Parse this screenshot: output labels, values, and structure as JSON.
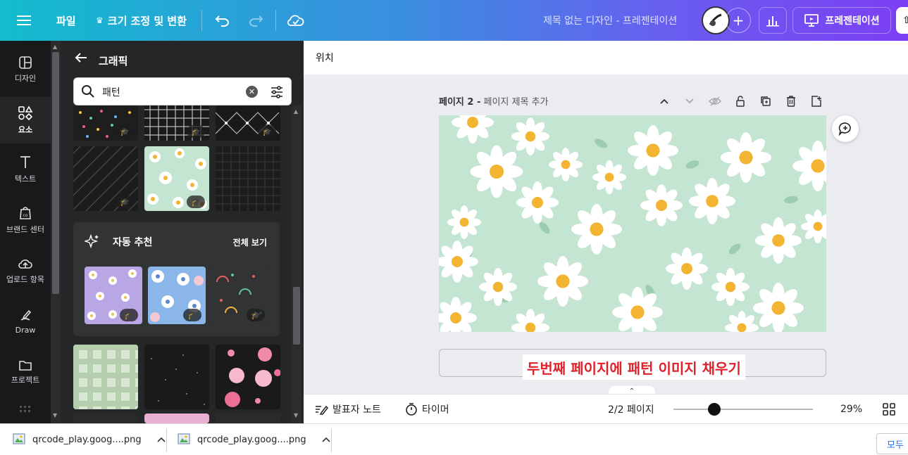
{
  "topbar": {
    "file": "파일",
    "resize": "크기 조정 및 변환",
    "doc_title": "제목 없는 디자인 - 프레젠테이션",
    "present": "프레젠테이션"
  },
  "rail": {
    "items": [
      {
        "label": "디자인",
        "icon": "layout-icon"
      },
      {
        "label": "요소",
        "icon": "shapes-icon"
      },
      {
        "label": "텍스트",
        "icon": "text-icon"
      },
      {
        "label": "브랜드 센터",
        "icon": "brand-icon"
      },
      {
        "label": "업로드 항목",
        "icon": "cloud-upload-icon"
      },
      {
        "label": "Draw",
        "icon": "draw-icon"
      },
      {
        "label": "프로젝트",
        "icon": "folder-icon"
      }
    ]
  },
  "panel": {
    "title": "그래픽",
    "search_value": "패턴",
    "auto_title": "자동 추천",
    "see_all": "전체 보기"
  },
  "canvas": {
    "position_label": "위치",
    "page_number": "페이지 2 -",
    "page_title_placeholder": "페이지 제목 추가",
    "annotation": "두번째 페이지에 패턴 이미지 채우기"
  },
  "bottombar": {
    "notes": "발표자 노트",
    "timer": "타이머",
    "pages": "2/2 페이지",
    "zoom": "29%",
    "zoom_fraction": 0.29
  },
  "downloads": {
    "items": [
      {
        "name": "qrcode_play.goog....png"
      },
      {
        "name": "qrcode_play.goog....png"
      }
    ],
    "show_all": "모두"
  },
  "colors": {
    "accent": "#7c3ff2",
    "pattern_bg": "#c5e5d3",
    "annotation_red": "#e0202a"
  }
}
